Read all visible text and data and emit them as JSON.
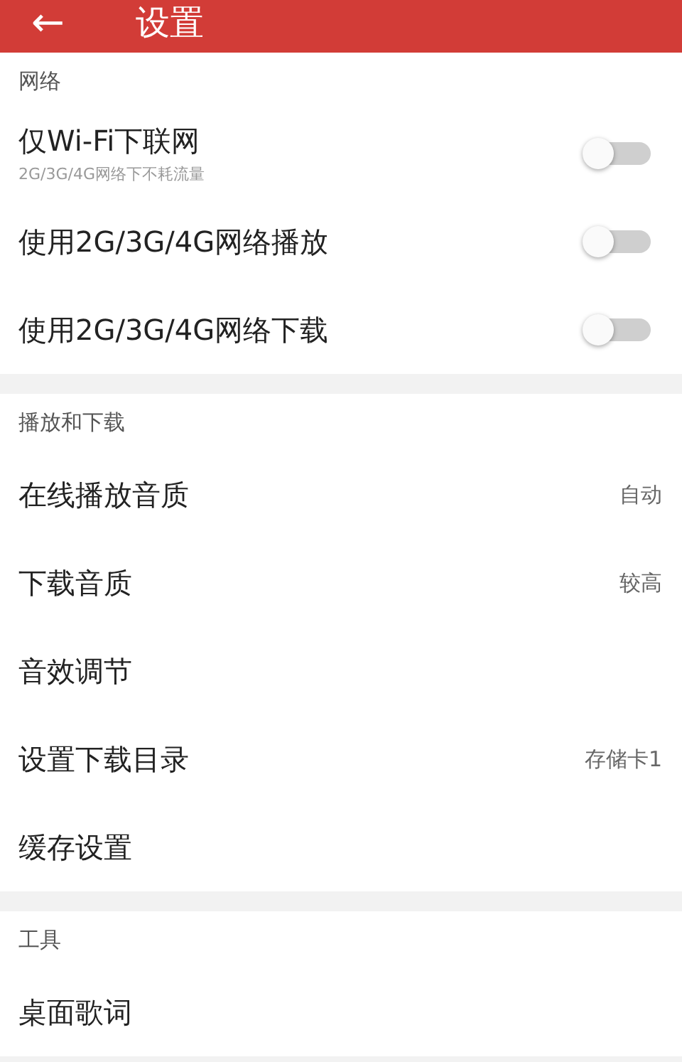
{
  "header": {
    "back_icon": "←",
    "title": "设置"
  },
  "sections": [
    {
      "title": "网络",
      "items": [
        {
          "kind": "switch",
          "label": "仅Wi-Fi下联网",
          "subtitle": "2G/3G/4G网络下不耗流量",
          "on": false
        },
        {
          "kind": "switch",
          "label": "使用2G/3G/4G网络播放",
          "on": false
        },
        {
          "kind": "switch",
          "label": "使用2G/3G/4G网络下载",
          "on": false
        }
      ]
    },
    {
      "title": "播放和下载",
      "items": [
        {
          "kind": "value",
          "label": "在线播放音质",
          "value": "自动"
        },
        {
          "kind": "value",
          "label": "下载音质",
          "value": "较高"
        },
        {
          "kind": "link",
          "label": "音效调节"
        },
        {
          "kind": "value",
          "label": "设置下载目录",
          "value": "存储卡1"
        },
        {
          "kind": "link",
          "label": "缓存设置"
        }
      ]
    },
    {
      "title": "工具",
      "items": [
        {
          "kind": "link",
          "label": "桌面歌词"
        }
      ]
    }
  ]
}
